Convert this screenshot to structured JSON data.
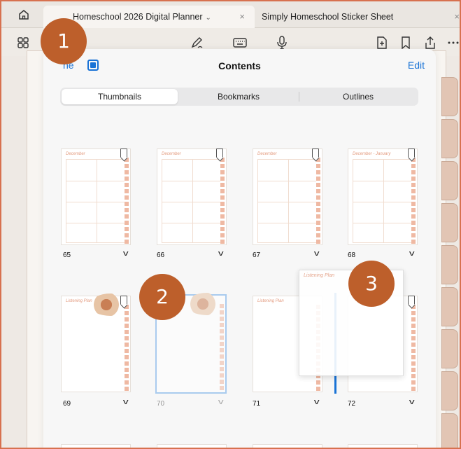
{
  "tabs": [
    {
      "title": "Homeschool 2026 Digital Planner",
      "close": "×"
    },
    {
      "title": "Simply Homeschool Sticker Sheet",
      "close": "×"
    }
  ],
  "tab_chevron": "⌄",
  "modal": {
    "done": "ne",
    "title": "Contents",
    "edit": "Edit",
    "segments": [
      "Thumbnails",
      "Bookmarks",
      "Outlines"
    ]
  },
  "thumbnails_row1": [
    {
      "page": "65",
      "header": "December"
    },
    {
      "page": "66",
      "header": "December"
    },
    {
      "page": "67",
      "header": "December"
    },
    {
      "page": "68",
      "header": "December - January"
    }
  ],
  "thumbnails_row2": [
    {
      "page": "69",
      "header": "Listening Plan"
    },
    {
      "page": "70",
      "header": ""
    },
    {
      "page": "71",
      "header": "Listening Plan"
    },
    {
      "page": "72",
      "header": ""
    }
  ],
  "dragged_page_header": "Listening Plan",
  "callouts": [
    "1",
    "2",
    "3"
  ],
  "side_tabs": [
    "",
    "",
    "",
    "",
    "",
    "",
    "",
    "",
    ""
  ],
  "colors": {
    "accent": "#1a73d6",
    "callout": "#bd5f2b",
    "frame": "#d7714f"
  }
}
